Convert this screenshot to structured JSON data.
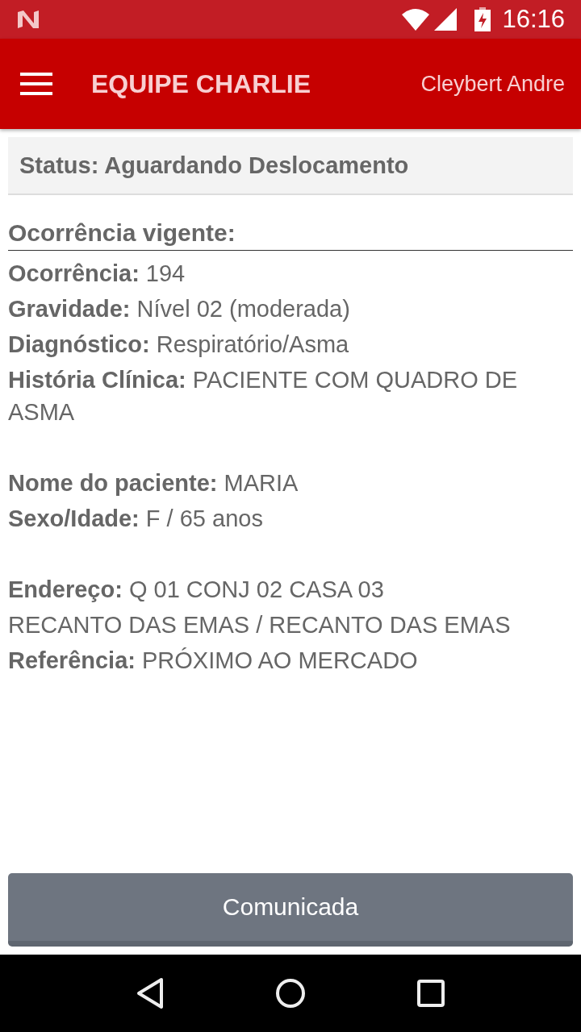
{
  "status_bar": {
    "time": "16:16"
  },
  "app_bar": {
    "title": "EQUIPE CHARLIE",
    "user": "Cleybert Andre"
  },
  "status": "Status: Aguardando Deslocamento",
  "section_title": "Ocorrência vigente:",
  "groups": [
    [
      {
        "text": "**Ocorrência:** 194"
      },
      {
        "text": "**Gravidade:** Nível 02 (moderada)"
      },
      {
        "text": "**Diagnóstico:** Respiratório/Asma"
      },
      {
        "text": "**História Clínica:** PACIENTE COM QUADRO DE ASMA"
      }
    ],
    [
      {
        "text": "**Nome do paciente:** MARIA"
      },
      {
        "text": "**Sexo/Idade:** F / 65 anos"
      }
    ],
    [
      {
        "text": "**Endereço:** Q 01 CONJ 02 CASA 03"
      },
      {
        "text": "RECANTO DAS EMAS / RECANTO DAS EMAS"
      },
      {
        "text": "**Referência:** PRÓXIMO AO MERCADO"
      }
    ]
  ],
  "button": "Comunicada"
}
